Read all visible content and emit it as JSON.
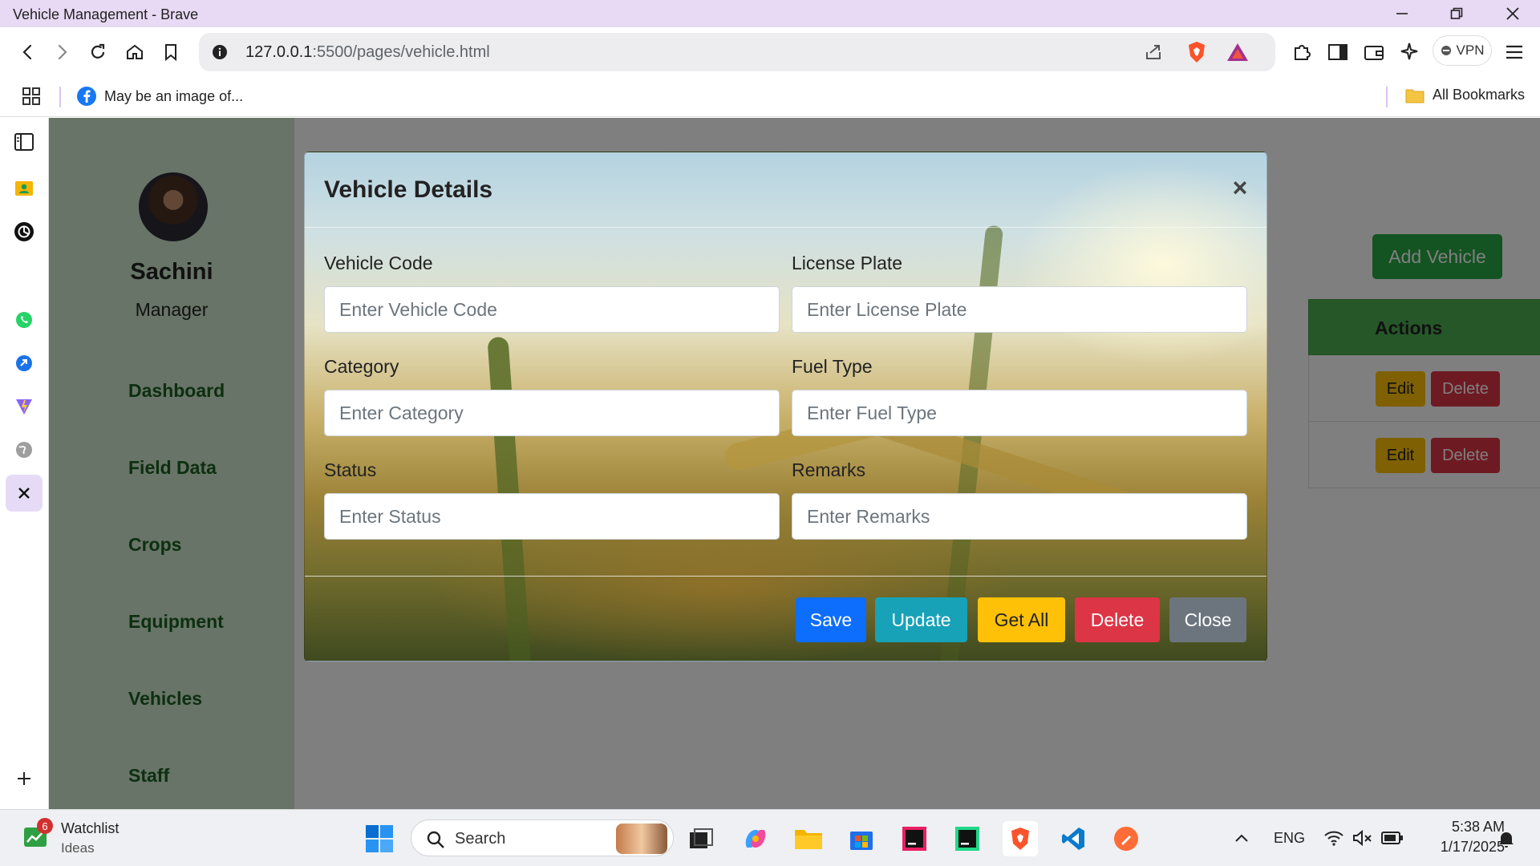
{
  "window": {
    "title": "Vehicle Management - Brave"
  },
  "toolbar": {
    "url_host": "127.0.0.1",
    "url_path": ":5500/pages/vehicle.html",
    "vpn_label": "VPN"
  },
  "bookmarks": {
    "item1": "May be an image of...",
    "all": "All Bookmarks"
  },
  "app_sidebar": {
    "user_name": "Sachini",
    "user_role": "Manager",
    "nav": [
      "Dashboard",
      "Field Data",
      "Crops",
      "Equipment",
      "Vehicles",
      "Staff"
    ]
  },
  "content": {
    "add_button": "Add Vehicle",
    "table": {
      "actions_header": "Actions",
      "edit_label": "Edit",
      "delete_label": "Delete"
    }
  },
  "modal": {
    "title": "Vehicle Details",
    "close_glyph": "×",
    "fields": {
      "vehicle_code": {
        "label": "Vehicle Code",
        "placeholder": "Enter Vehicle Code"
      },
      "license_plate": {
        "label": "License Plate",
        "placeholder": "Enter License Plate"
      },
      "category": {
        "label": "Category",
        "placeholder": "Enter Category"
      },
      "fuel_type": {
        "label": "Fuel Type",
        "placeholder": "Enter Fuel Type"
      },
      "status": {
        "label": "Status",
        "placeholder": "Enter Status"
      },
      "remarks": {
        "label": "Remarks",
        "placeholder": "Enter Remarks"
      }
    },
    "buttons": {
      "save": "Save",
      "update": "Update",
      "get_all": "Get All",
      "delete": "Delete",
      "close": "Close"
    }
  },
  "taskbar": {
    "widget_title": "Watchlist",
    "widget_sub": "Ideas",
    "widget_badge": "6",
    "search_placeholder": "Search",
    "language": "ENG",
    "time": "5:38 AM",
    "date": "1/17/2025"
  },
  "colors": {
    "save": "#0d6efd",
    "update": "#17a2b8",
    "get_all": "#ffc107",
    "delete": "#dc3545",
    "close": "#6c757d",
    "nav_text": "#1b5e20",
    "sidebar_bg": "#cfe8cf",
    "add_button": "#28a745",
    "table_header": "#4caf50"
  }
}
